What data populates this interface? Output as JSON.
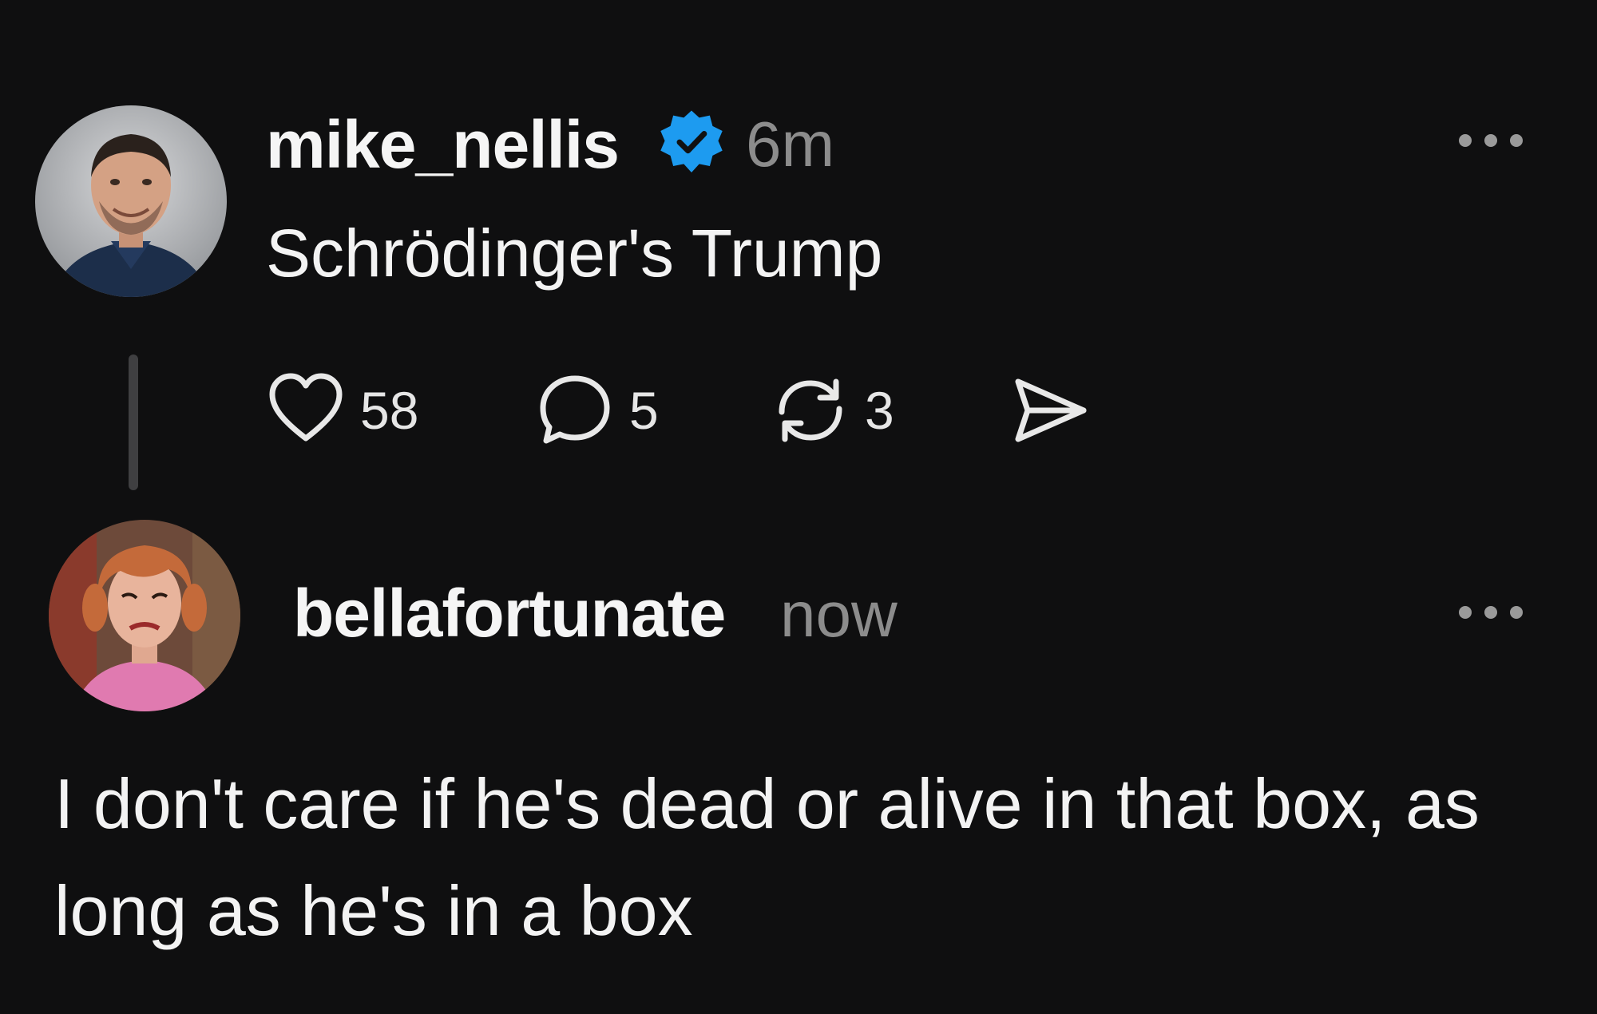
{
  "post": {
    "username": "mike_nellis",
    "timestamp": "6m",
    "text": "Schrödinger's Trump",
    "verified_icon": "verified-badge-icon",
    "actions": {
      "likes": "58",
      "replies": "5",
      "reposts": "3"
    }
  },
  "reply": {
    "username": "bellafortunate",
    "timestamp": "now",
    "text": "I don't care if he's dead or alive in that box, as long as he's in a box"
  },
  "colors": {
    "background": "#0f0f10",
    "verified": "#1d9bf0",
    "muted_text": "#8c8c8c"
  }
}
